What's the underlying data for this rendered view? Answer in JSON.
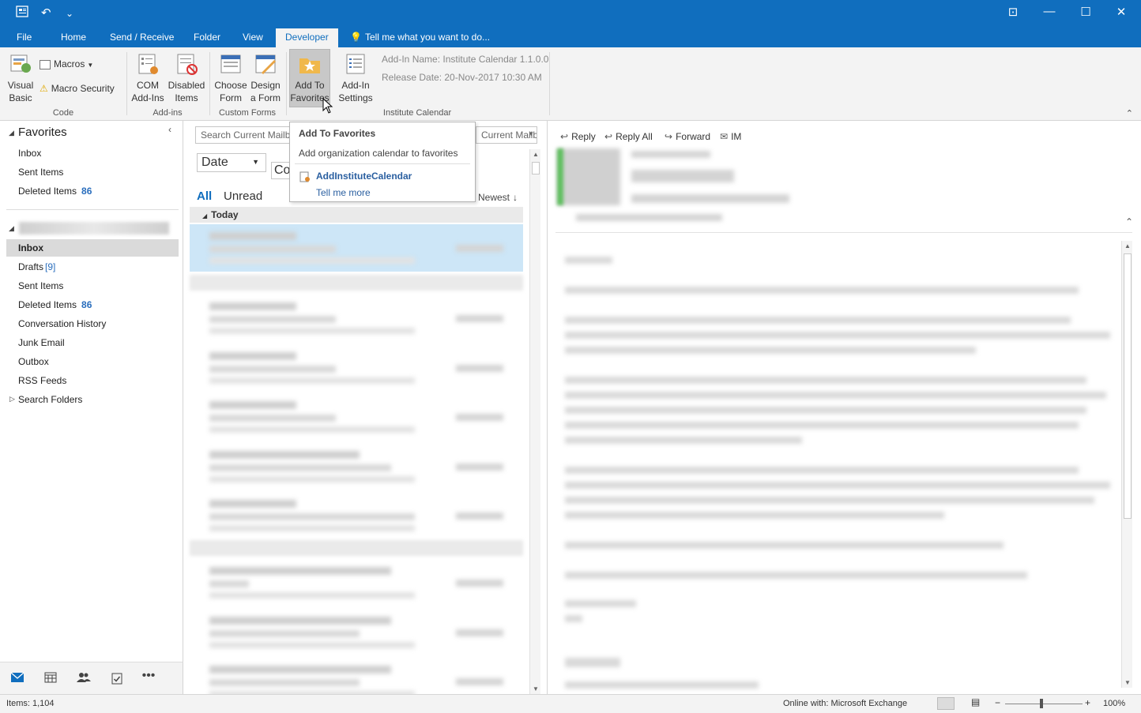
{
  "window": {
    "minimize_glyph": "—",
    "restore_glyph": "☐",
    "close_glyph": "✕",
    "ribbon_display_glyph": "⊡"
  },
  "qat": {
    "icon": "send-receive-icon",
    "undo_glyph": "↶",
    "customize_glyph": "⌄"
  },
  "tabs": [
    {
      "label": "File"
    },
    {
      "label": "Home"
    },
    {
      "label": "Send / Receive"
    },
    {
      "label": "Folder"
    },
    {
      "label": "View"
    },
    {
      "label": "Developer"
    }
  ],
  "tell_me": "Tell me what you want to do...",
  "ribbon": {
    "code": {
      "label": "Code",
      "visual_basic": "Visual\nBasic",
      "macros": "Macros",
      "macro_security": "Macro Security"
    },
    "addins": {
      "label": "Add-ins",
      "com": "COM\nAdd-Ins",
      "disabled": "Disabled\nItems"
    },
    "custom_forms": {
      "label": "Custom Forms",
      "choose": "Choose\nForm",
      "design": "Design\na Form"
    },
    "institute": {
      "label": "Institute Calendar",
      "add_favorites": "Add To\nFavorites",
      "settings": "Add-In\nSettings",
      "name_line": "Add-In Name: Institute Calendar 1.1.0.0",
      "release_line": "Release Date:  20-Nov-2017 10:30 AM"
    },
    "collapse_glyph": "⌃"
  },
  "tooltip": {
    "title": "Add To Favorites",
    "description": "Add organization calendar to favorites",
    "link": "AddInstituteCalendar",
    "more": "Tell me more"
  },
  "folders": {
    "favorites_header": "Favorites",
    "favorites": [
      {
        "label": "Inbox"
      },
      {
        "label": "Sent Items"
      },
      {
        "label": "Deleted Items",
        "count": "86"
      }
    ],
    "mailbox": [
      {
        "label": "Inbox"
      },
      {
        "label": "Drafts",
        "count": "[9]"
      },
      {
        "label": "Sent Items"
      },
      {
        "label": "Deleted Items",
        "count": "86"
      },
      {
        "label": "Conversation History"
      },
      {
        "label": "Junk Email"
      },
      {
        "label": "Outbox"
      },
      {
        "label": "RSS Feeds"
      },
      {
        "label": "Search Folders"
      }
    ]
  },
  "nav": [
    "mail-icon",
    "calendar-icon",
    "people-icon",
    "tasks-icon",
    "more-icon"
  ],
  "list": {
    "search_placeholder": "Search Current Mailbox",
    "scope": "Current Mailbox",
    "date_sort": "Date",
    "con_sort": "Con",
    "filter_all": "All",
    "filter_unread": "Unread",
    "order": "Newest",
    "group_today": "Today"
  },
  "reading": {
    "reply": "Reply",
    "reply_all": "Reply All",
    "forward": "Forward",
    "im": "IM"
  },
  "status": {
    "items": "Items: 1,104",
    "connection": "Online with: Microsoft Exchange",
    "zoom": "100%"
  },
  "colors": {
    "accent": "#106ebe",
    "ribbon_bg": "#f3f3f3",
    "selected_msg": "#cde6f7"
  }
}
